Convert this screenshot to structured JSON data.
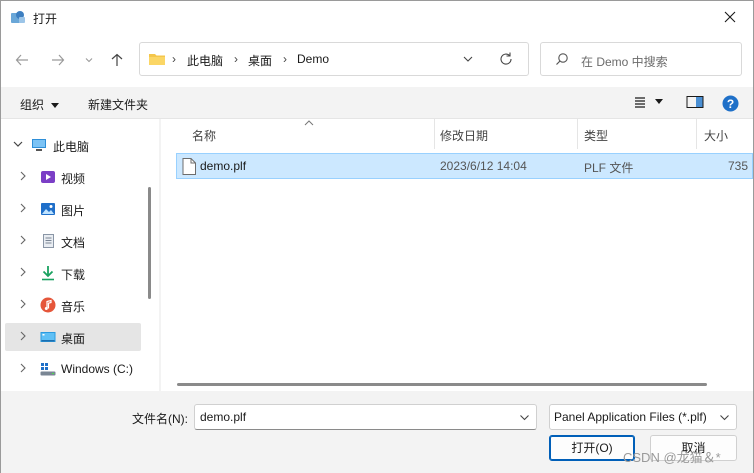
{
  "window": {
    "title": "打开"
  },
  "address": {
    "crumbs": [
      "此电脑",
      "桌面",
      "Demo"
    ]
  },
  "search": {
    "placeholder": "在 Demo 中搜索"
  },
  "toolbar": {
    "organize": "组织",
    "new_folder": "新建文件夹"
  },
  "sidebar": {
    "items": [
      {
        "label": "此电脑",
        "icon": "pc-icon",
        "expanded": true
      },
      {
        "label": "视频",
        "icon": "video-icon"
      },
      {
        "label": "图片",
        "icon": "pictures-icon"
      },
      {
        "label": "文档",
        "icon": "documents-icon"
      },
      {
        "label": "下载",
        "icon": "download-icon"
      },
      {
        "label": "音乐",
        "icon": "music-icon"
      },
      {
        "label": "桌面",
        "icon": "desktop-icon",
        "selected": true
      },
      {
        "label": "Windows (C:)",
        "icon": "drive-icon"
      }
    ]
  },
  "columns": {
    "name": "名称",
    "modified": "修改日期",
    "type": "类型",
    "size": "大小"
  },
  "files": [
    {
      "name": "demo.plf",
      "modified": "2023/6/12 14:04",
      "type": "PLF 文件",
      "size": "735"
    }
  ],
  "bottom": {
    "filename_label": "文件名(N):",
    "filename_value": "demo.plf",
    "filter_value": "Panel Application Files (*.plf)",
    "open_label": "打开(O)",
    "cancel_label": "取消",
    "watermark": "CSDN @龙猫＆*"
  },
  "colors": {
    "accent": "#005fb8",
    "selection": "#cce8ff",
    "selection_border": "#99d1ff"
  }
}
